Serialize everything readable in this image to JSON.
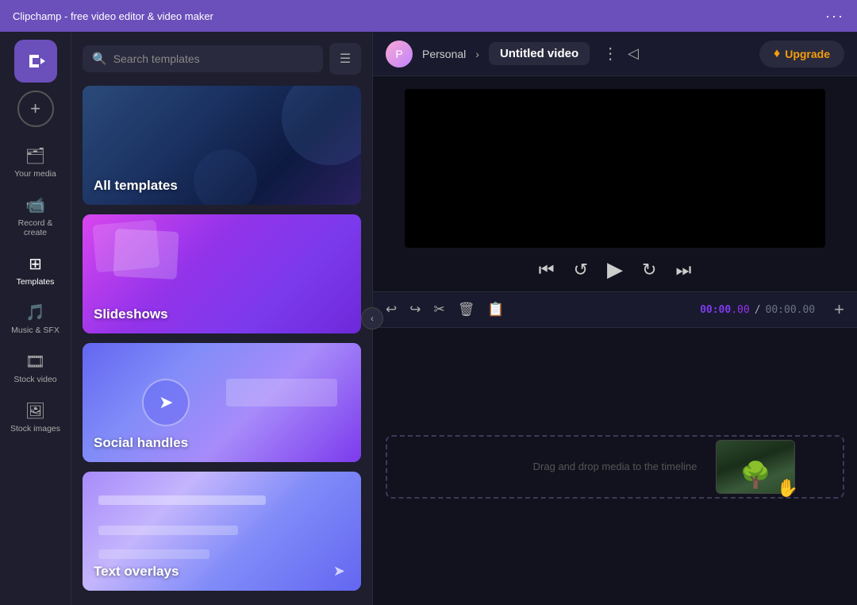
{
  "titlebar": {
    "title": "Clipchamp - free video editor & video maker",
    "more_label": "···"
  },
  "nav": {
    "logo_alt": "Clipchamp logo",
    "add_label": "+",
    "items": [
      {
        "id": "your-media",
        "icon": "🗂",
        "label": "Your media",
        "active": false
      },
      {
        "id": "record",
        "icon": "📹",
        "label": "Record &\ncreate",
        "active": false
      },
      {
        "id": "templates",
        "icon": "⊞",
        "label": "Templates",
        "active": true
      },
      {
        "id": "music",
        "icon": "🎵",
        "label": "Music & SFX",
        "active": false
      },
      {
        "id": "stock-video",
        "icon": "🎞",
        "label": "Stock video",
        "active": false
      },
      {
        "id": "stock-images",
        "icon": "🖼",
        "label": "Stock images",
        "active": false
      }
    ]
  },
  "templates_panel": {
    "search_placeholder": "Search templates",
    "filter_icon": "≡",
    "cards": [
      {
        "id": "all-templates",
        "label": "All templates",
        "class": "card-all"
      },
      {
        "id": "slideshows",
        "label": "Slideshows",
        "class": "card-slideshows"
      },
      {
        "id": "social-handles",
        "label": "Social handles",
        "class": "card-social"
      },
      {
        "id": "text-overlays",
        "label": "Text overlays",
        "class": "card-text"
      }
    ]
  },
  "editor": {
    "user_initial": "P",
    "breadcrumb_arrow": "›",
    "personal_label": "Personal",
    "video_title": "Untitled video",
    "more_icon": "⋮",
    "share_icon": "◁",
    "upgrade_label": "Upgrade",
    "diamond_icon": "♦"
  },
  "playback": {
    "skip_back_icon": "⏮",
    "rewind_icon": "↩",
    "play_icon": "▶",
    "forward_icon": "↪",
    "skip_forward_icon": "⏭"
  },
  "timeline": {
    "undo_icon": "↩",
    "redo_icon": "↪",
    "cut_icon": "✂",
    "delete_icon": "🗑",
    "clip_icon": "📋",
    "timecode_current": "00:00",
    "timecode_current_sub": ".00",
    "timecode_sep": "/",
    "timecode_total": "00:00",
    "timecode_total_sub": ".00",
    "add_icon": "+",
    "drop_label": "Drag and drop media to the timeline"
  }
}
